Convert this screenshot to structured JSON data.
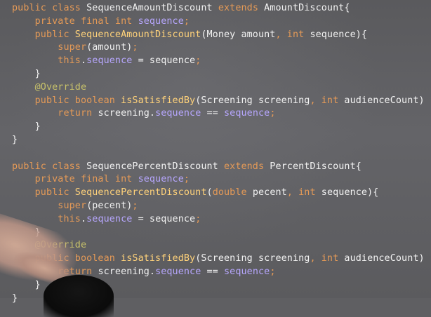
{
  "code": {
    "lines": [
      [
        {
          "t": "public class ",
          "c": "kw"
        },
        {
          "t": "SequenceAmountDiscount ",
          "c": "op"
        },
        {
          "t": "extends ",
          "c": "kw"
        },
        {
          "t": "AmountDiscount{",
          "c": "op"
        }
      ],
      [
        {
          "t": "    private final int ",
          "c": "kw"
        },
        {
          "t": "sequence",
          "c": "fld"
        },
        {
          "t": ";",
          "c": "semi"
        }
      ],
      [
        {
          "t": "    public ",
          "c": "kw"
        },
        {
          "t": "SequenceAmountDiscount",
          "c": "fn"
        },
        {
          "t": "(Money amount",
          "c": "op"
        },
        {
          "t": ", ",
          "c": "semi"
        },
        {
          "t": "int ",
          "c": "kw"
        },
        {
          "t": "sequence){",
          "c": "op"
        }
      ],
      [
        {
          "t": "        super",
          "c": "kw"
        },
        {
          "t": "(amount)",
          "c": "op"
        },
        {
          "t": ";",
          "c": "semi"
        }
      ],
      [
        {
          "t": "        this",
          "c": "kw"
        },
        {
          "t": ".",
          "c": "op"
        },
        {
          "t": "sequence",
          "c": "fld"
        },
        {
          "t": " = sequence",
          "c": "op"
        },
        {
          "t": ";",
          "c": "semi"
        }
      ],
      [
        {
          "t": "    }",
          "c": "op"
        }
      ],
      [
        {
          "t": "    @Override",
          "c": "ann"
        }
      ],
      [
        {
          "t": "    public boolean ",
          "c": "kw"
        },
        {
          "t": "isSatisfiedBy",
          "c": "fn"
        },
        {
          "t": "(Screening screening",
          "c": "op"
        },
        {
          "t": ", ",
          "c": "semi"
        },
        {
          "t": "int ",
          "c": "kw"
        },
        {
          "t": "audienceCount) {",
          "c": "op"
        }
      ],
      [
        {
          "t": "        return ",
          "c": "kw"
        },
        {
          "t": "screening.",
          "c": "op"
        },
        {
          "t": "sequence",
          "c": "fld"
        },
        {
          "t": " == ",
          "c": "op"
        },
        {
          "t": "sequence",
          "c": "fld"
        },
        {
          "t": ";",
          "c": "semi"
        }
      ],
      [
        {
          "t": "    }",
          "c": "op"
        }
      ],
      [
        {
          "t": "}",
          "c": "op"
        }
      ],
      [
        {
          "t": "",
          "c": "op"
        }
      ],
      [
        {
          "t": "public class ",
          "c": "kw"
        },
        {
          "t": "SequencePercentDiscount ",
          "c": "op"
        },
        {
          "t": "extends ",
          "c": "kw"
        },
        {
          "t": "PercentDiscount{",
          "c": "op"
        }
      ],
      [
        {
          "t": "    private final int ",
          "c": "kw"
        },
        {
          "t": "sequence",
          "c": "fld"
        },
        {
          "t": ";",
          "c": "semi"
        }
      ],
      [
        {
          "t": "    public ",
          "c": "kw"
        },
        {
          "t": "SequencePercentDiscount",
          "c": "fn"
        },
        {
          "t": "(",
          "c": "op"
        },
        {
          "t": "double ",
          "c": "kw"
        },
        {
          "t": "pecent",
          "c": "op"
        },
        {
          "t": ", ",
          "c": "semi"
        },
        {
          "t": "int ",
          "c": "kw"
        },
        {
          "t": "sequence){",
          "c": "op"
        }
      ],
      [
        {
          "t": "        super",
          "c": "kw"
        },
        {
          "t": "(pecent)",
          "c": "op"
        },
        {
          "t": ";",
          "c": "semi"
        }
      ],
      [
        {
          "t": "        this",
          "c": "kw"
        },
        {
          "t": ".",
          "c": "op"
        },
        {
          "t": "sequence",
          "c": "fld"
        },
        {
          "t": " = sequence",
          "c": "op"
        },
        {
          "t": ";",
          "c": "semi"
        }
      ],
      [
        {
          "t": "    }",
          "c": "op"
        }
      ],
      [
        {
          "t": "    @Override",
          "c": "ann"
        }
      ],
      [
        {
          "t": "    public boolean ",
          "c": "kw"
        },
        {
          "t": "isSatisfiedBy",
          "c": "fn"
        },
        {
          "t": "(Screening screening",
          "c": "op"
        },
        {
          "t": ", ",
          "c": "semi"
        },
        {
          "t": "int ",
          "c": "kw"
        },
        {
          "t": "audienceCount) {",
          "c": "op"
        }
      ],
      [
        {
          "t": "        return ",
          "c": "kw"
        },
        {
          "t": "screening.",
          "c": "op"
        },
        {
          "t": "sequence",
          "c": "fld"
        },
        {
          "t": " == ",
          "c": "op"
        },
        {
          "t": "sequence",
          "c": "fld"
        },
        {
          "t": ";",
          "c": "semi"
        }
      ],
      [
        {
          "t": "    }",
          "c": "op"
        }
      ],
      [
        {
          "t": "}",
          "c": "op"
        }
      ]
    ]
  },
  "colors": {
    "background": "#5f5f62",
    "keyword": "#e59a57",
    "function": "#ffd27a",
    "field": "#b7a7ff",
    "annotation": "#c8c26a",
    "text": "#f2f2f2"
  }
}
